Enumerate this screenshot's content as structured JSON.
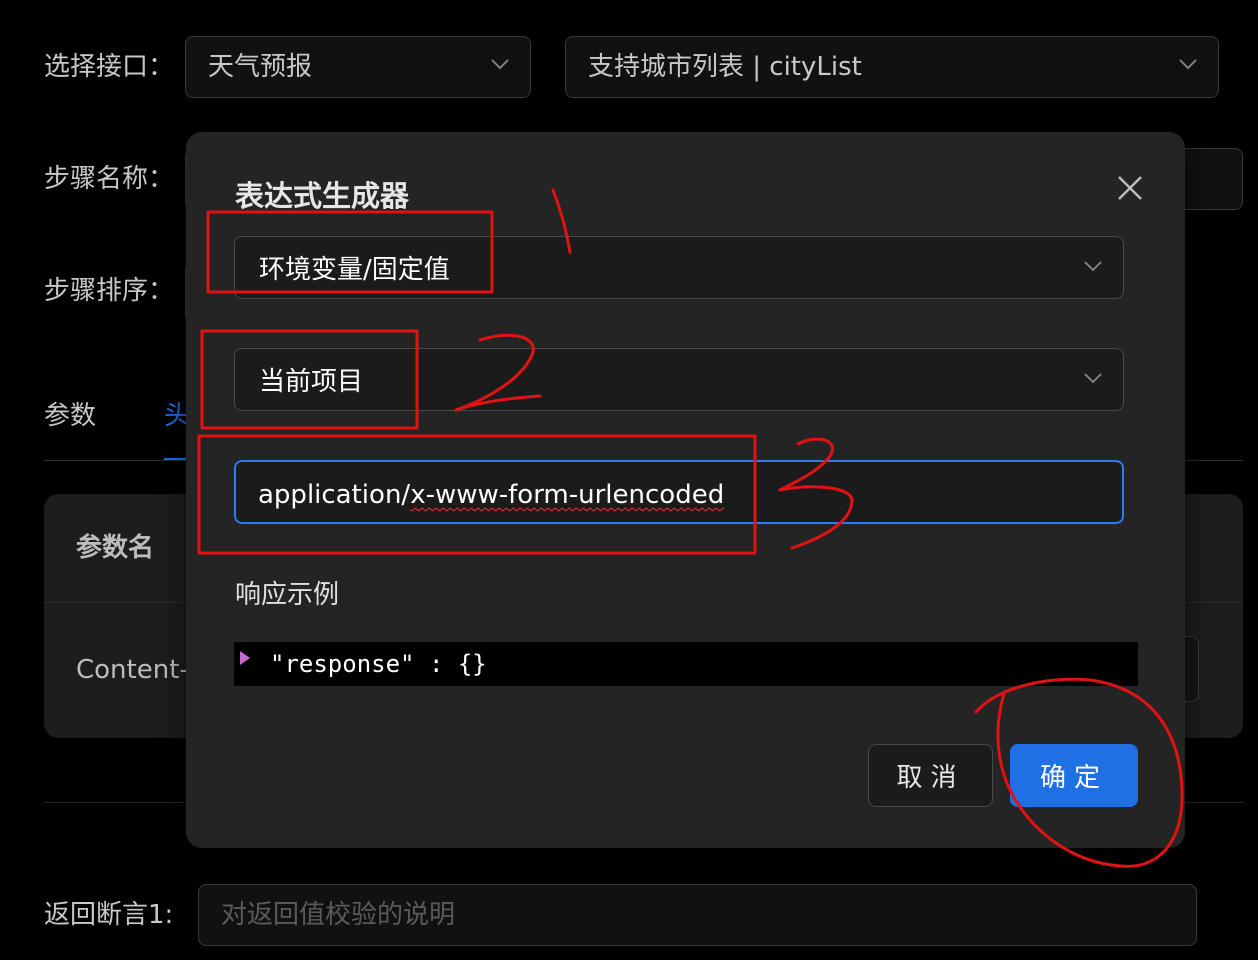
{
  "form": {
    "interface_label": "选择接口：",
    "interface_value": "天气预报",
    "api_value": "支持城市列表 | cityList",
    "step_name_label": "步骤名称：",
    "step_order_label": "步骤排序：",
    "tabs": [
      "参数",
      "头"
    ],
    "table": {
      "header_param_name": "参数名",
      "row1_name": "Content-"
    },
    "assert_label": "返回断言1:",
    "assert_placeholder": "对返回值校验的说明"
  },
  "modal": {
    "title": "表达式生成器",
    "select1_value": "环境变量/固定值",
    "select2_value": "当前项目",
    "input_value_prefix": "application/",
    "input_value_misspelled": "x-www-form-urlencoded",
    "response_label": "响应示例",
    "code_line": "\"response\" : {}",
    "cancel_label": "取消",
    "ok_label": "确定"
  },
  "colors": {
    "annotation": "#e01212",
    "primary": "#1f6fe5",
    "tab_active": "#1f6fe5"
  },
  "icons": [
    "chevron-down-icon",
    "close-icon",
    "caret-right-icon"
  ]
}
